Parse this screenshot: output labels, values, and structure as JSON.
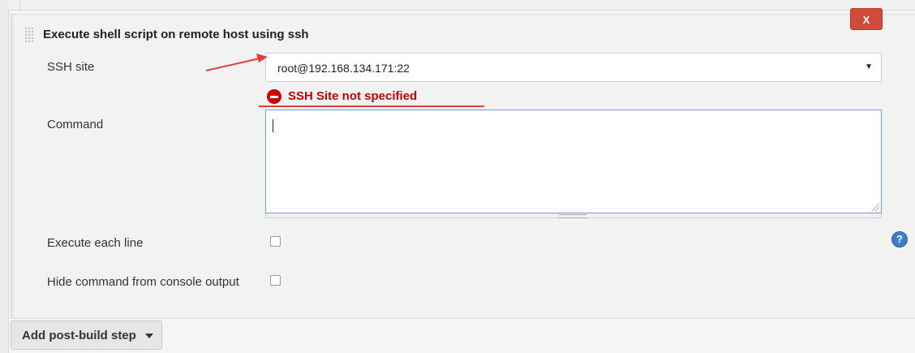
{
  "build_step": {
    "title": "Execute shell script on remote host using ssh",
    "delete_label": "X"
  },
  "fields": {
    "ssh_site_label": "SSH site",
    "ssh_site_value": "root@192.168.134.171:22",
    "ssh_site_error": "SSH Site not specified",
    "command_label": "Command",
    "command_value": "",
    "execute_each_line_label": "Execute each line",
    "execute_each_line_checked": false,
    "hide_command_label": "Hide command from console output",
    "hide_command_checked": false
  },
  "help_label": "?",
  "footer": {
    "add_post_build_step_label": "Add post-build step"
  },
  "colors": {
    "delete_button": "#d24b3a",
    "error_text": "#c00000",
    "annotation": "#e0403a",
    "help_icon": "#3d7ec8",
    "textarea_focus_border": "#6aa0e0"
  },
  "icons": {
    "error": "minus-circle",
    "help": "question-circle",
    "dropdown": "caret-down"
  }
}
